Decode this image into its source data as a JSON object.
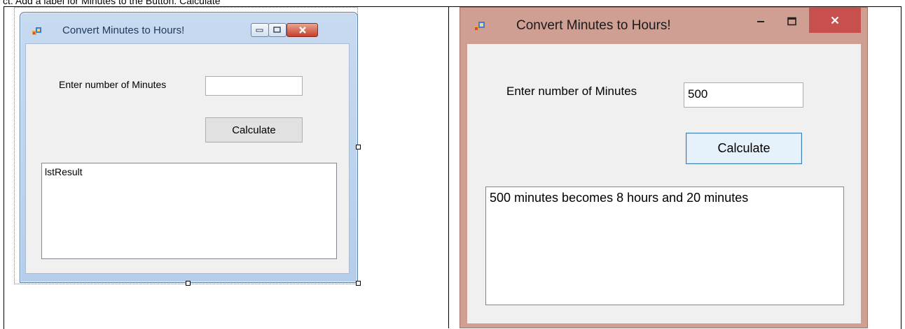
{
  "document": {
    "top_text": "ct. Add a label for Minutes to the Button: Calculate"
  },
  "left_window": {
    "title": "Convert Minutes to Hours!",
    "minutes_label": "Enter number of Minutes",
    "minutes_value": "",
    "calculate_label": "Calculate",
    "list_items": [
      "lstResult"
    ],
    "icon": "app-icon"
  },
  "right_window": {
    "title": "Convert Minutes to Hours!",
    "minutes_label": "Enter number of Minutes",
    "minutes_value": "500",
    "calculate_label": "Calculate",
    "list_items": [
      "500 minutes becomes 8 hours and 20 minutes"
    ],
    "icon": "app-icon",
    "frame_color": "#d09f93",
    "close_color": "#c7504f"
  }
}
